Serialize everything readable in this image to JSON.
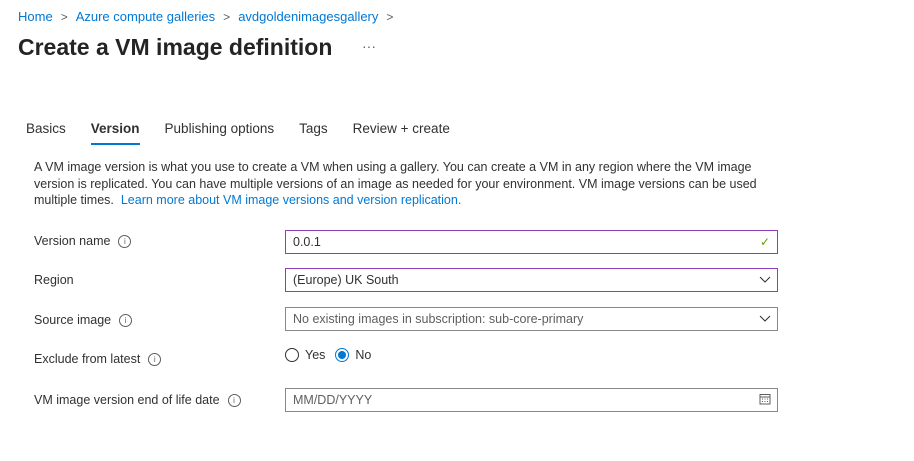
{
  "breadcrumb": [
    "Home",
    "Azure compute galleries",
    "avdgoldenimagesgallery"
  ],
  "title": "Create a VM image definition",
  "more": "···",
  "tabs": [
    "Basics",
    "Version",
    "Publishing options",
    "Tags",
    "Review + create"
  ],
  "active_tab": "Version",
  "description": "A VM image version is what you use to create a VM when using a gallery. You can create a VM in any region where the VM image version is replicated. You can have multiple versions of an image as needed for your environment. VM image versions can be used multiple times.",
  "learn_more": "Learn more about VM image versions and version replication.",
  "form": {
    "version_name": {
      "label": "Version name",
      "value": "0.0.1"
    },
    "region": {
      "label": "Region",
      "value": "(Europe) UK South"
    },
    "source_image": {
      "label": "Source image",
      "placeholder": "No existing images in subscription: sub-core-primary"
    },
    "exclude": {
      "label": "Exclude from latest",
      "options": [
        "Yes",
        "No"
      ],
      "selected": "No"
    },
    "eol": {
      "label": "VM image version end of life date",
      "placeholder": "MM/DD/YYYY"
    }
  },
  "colors": {
    "accent": "#0078d4",
    "valid_border": "#8f3fb5",
    "check": "#57a300"
  }
}
